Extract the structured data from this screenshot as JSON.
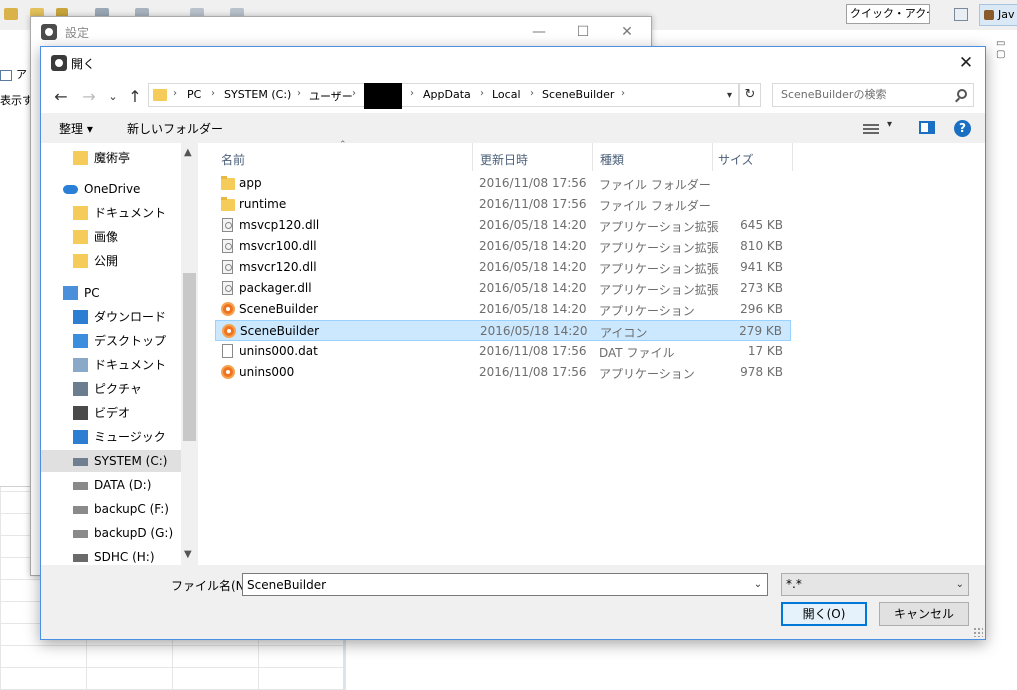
{
  "ide": {
    "quick_access": "クイック・アクセス",
    "java_perspective": "Jav",
    "left_tab": "ア",
    "left_text": "表示す"
  },
  "settings_window": {
    "title": "設定",
    "minimize": "—",
    "maximize": "☐",
    "close": "✕"
  },
  "dialog": {
    "title": "開く",
    "close": "✕",
    "nav": {
      "back": "←",
      "forward": "→",
      "recent": "⌄",
      "up": "↑"
    },
    "breadcrumbs": [
      "PC",
      "SYSTEM (C:)",
      "ユーザー",
      "AppData",
      "Local",
      "SceneBuilder"
    ],
    "search_placeholder": "SceneBuilderの検索",
    "toolbar": {
      "organize": "整理 ▾",
      "new_folder": "新しいフォルダー",
      "view_dropdown": "▾",
      "help": "?"
    },
    "nav_tree": [
      {
        "label": "魔術亭",
        "icon": "folder-icon",
        "indent": 1
      },
      {
        "label": "OneDrive",
        "icon": "onedrive-icon",
        "indent": 0
      },
      {
        "label": "ドキュメント",
        "icon": "synced-folder-icon",
        "indent": 1
      },
      {
        "label": "画像",
        "icon": "synced-folder-icon",
        "indent": 1
      },
      {
        "label": "公開",
        "icon": "shared-folder-icon",
        "indent": 1
      },
      {
        "label": "PC",
        "icon": "pc-icon",
        "indent": 0
      },
      {
        "label": "ダウンロード",
        "icon": "download-icon",
        "indent": 1
      },
      {
        "label": "デスクトップ",
        "icon": "desktop-icon",
        "indent": 1
      },
      {
        "label": "ドキュメント",
        "icon": "documents-icon",
        "indent": 1
      },
      {
        "label": "ピクチャ",
        "icon": "pictures-icon",
        "indent": 1
      },
      {
        "label": "ビデオ",
        "icon": "video-icon",
        "indent": 1
      },
      {
        "label": "ミュージック",
        "icon": "music-icon",
        "indent": 1
      },
      {
        "label": "SYSTEM (C:)",
        "icon": "system-drive-icon",
        "indent": 1,
        "selected": true
      },
      {
        "label": "DATA (D:)",
        "icon": "drive-icon",
        "indent": 1
      },
      {
        "label": "backupC (F:)",
        "icon": "drive-icon",
        "indent": 1
      },
      {
        "label": "backupD (G:)",
        "icon": "drive-icon",
        "indent": 1
      },
      {
        "label": "SDHC (H:)",
        "icon": "sd-card-icon",
        "indent": 1
      }
    ],
    "columns": {
      "name": "名前",
      "modified": "更新日時",
      "type": "種類",
      "size": "サイズ"
    },
    "files": [
      {
        "name": "app",
        "date": "2016/11/08 17:56",
        "type": "ファイル フォルダー",
        "size": "",
        "icon": "folder-icon"
      },
      {
        "name": "runtime",
        "date": "2016/11/08 17:56",
        "type": "ファイル フォルダー",
        "size": "",
        "icon": "folder-icon"
      },
      {
        "name": "msvcp120.dll",
        "date": "2016/05/18 14:20",
        "type": "アプリケーション拡張",
        "size": "645 KB",
        "icon": "dll-icon"
      },
      {
        "name": "msvcr100.dll",
        "date": "2016/05/18 14:20",
        "type": "アプリケーション拡張",
        "size": "810 KB",
        "icon": "dll-icon"
      },
      {
        "name": "msvcr120.dll",
        "date": "2016/05/18 14:20",
        "type": "アプリケーション拡張",
        "size": "941 KB",
        "icon": "dll-icon"
      },
      {
        "name": "packager.dll",
        "date": "2016/05/18 14:20",
        "type": "アプリケーション拡張",
        "size": "273 KB",
        "icon": "dll-icon"
      },
      {
        "name": "SceneBuilder",
        "date": "2016/05/18 14:20",
        "type": "アプリケーション",
        "size": "296 KB",
        "icon": "app-icon"
      },
      {
        "name": "SceneBuilder",
        "date": "2016/05/18 14:20",
        "type": "アイコン",
        "size": "279 KB",
        "icon": "app-icon",
        "selected": true
      },
      {
        "name": "unins000.dat",
        "date": "2016/11/08 17:56",
        "type": "DAT ファイル",
        "size": "17 KB",
        "icon": "file-icon"
      },
      {
        "name": "unins000",
        "date": "2016/11/08 17:56",
        "type": "アプリケーション",
        "size": "978 KB",
        "icon": "app-icon"
      }
    ],
    "filename_label": "ファイル名(N):",
    "filename_value": "SceneBuilder",
    "filter_value": "*.*",
    "open_button": "開く(O)",
    "cancel_button": "キャンセル"
  }
}
